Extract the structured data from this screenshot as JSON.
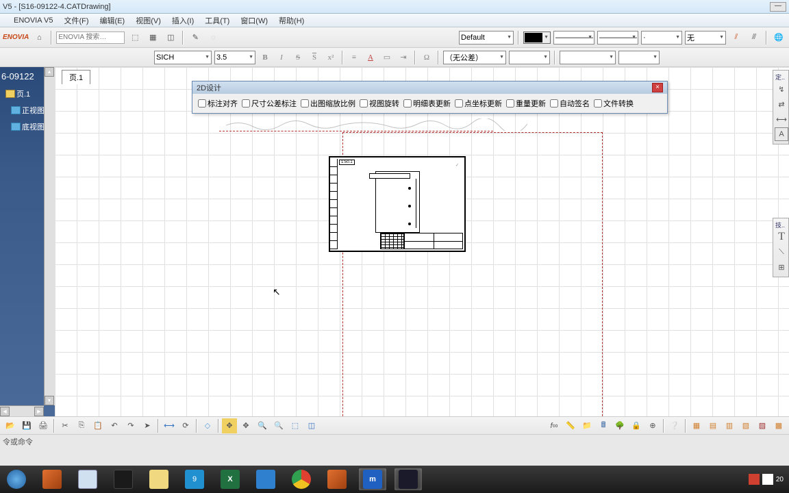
{
  "title_bar": {
    "text": "V5 - [S16-09122-4.CATDrawing]"
  },
  "menu": {
    "enovia": "ENOVIA V5",
    "file": "文件(F)",
    "edit": "编辑(E)",
    "view": "视图(V)",
    "insert": "插入(I)",
    "tools": "工具(T)",
    "window": "窗口(W)",
    "help": "帮助(H)"
  },
  "toolbar": {
    "search_placeholder": "ENOVIA 搜索…",
    "style_select": "Default",
    "line_weight": "—————",
    "line_type": "—————",
    "point_style": "·",
    "layer": "无"
  },
  "toolbar2": {
    "font_select": "SICH",
    "size_select": "3.5",
    "tolerance_select": "（无公差）"
  },
  "tree": {
    "root": "6-09122",
    "sheet": "页.1",
    "view1": "正视图",
    "view2": "底视图"
  },
  "canvas": {
    "sheet_tab": "页.1"
  },
  "dialog_2d": {
    "title": "2D设计",
    "opts": [
      "标注对齐",
      "尺寸公差标注",
      "出图缩放比例",
      "视图旋转",
      "明细表更新",
      "点坐标更新",
      "重量更新",
      "自动签名",
      "文件转换"
    ]
  },
  "status": {
    "text": "令或命令"
  },
  "systray": {
    "time": "20"
  }
}
